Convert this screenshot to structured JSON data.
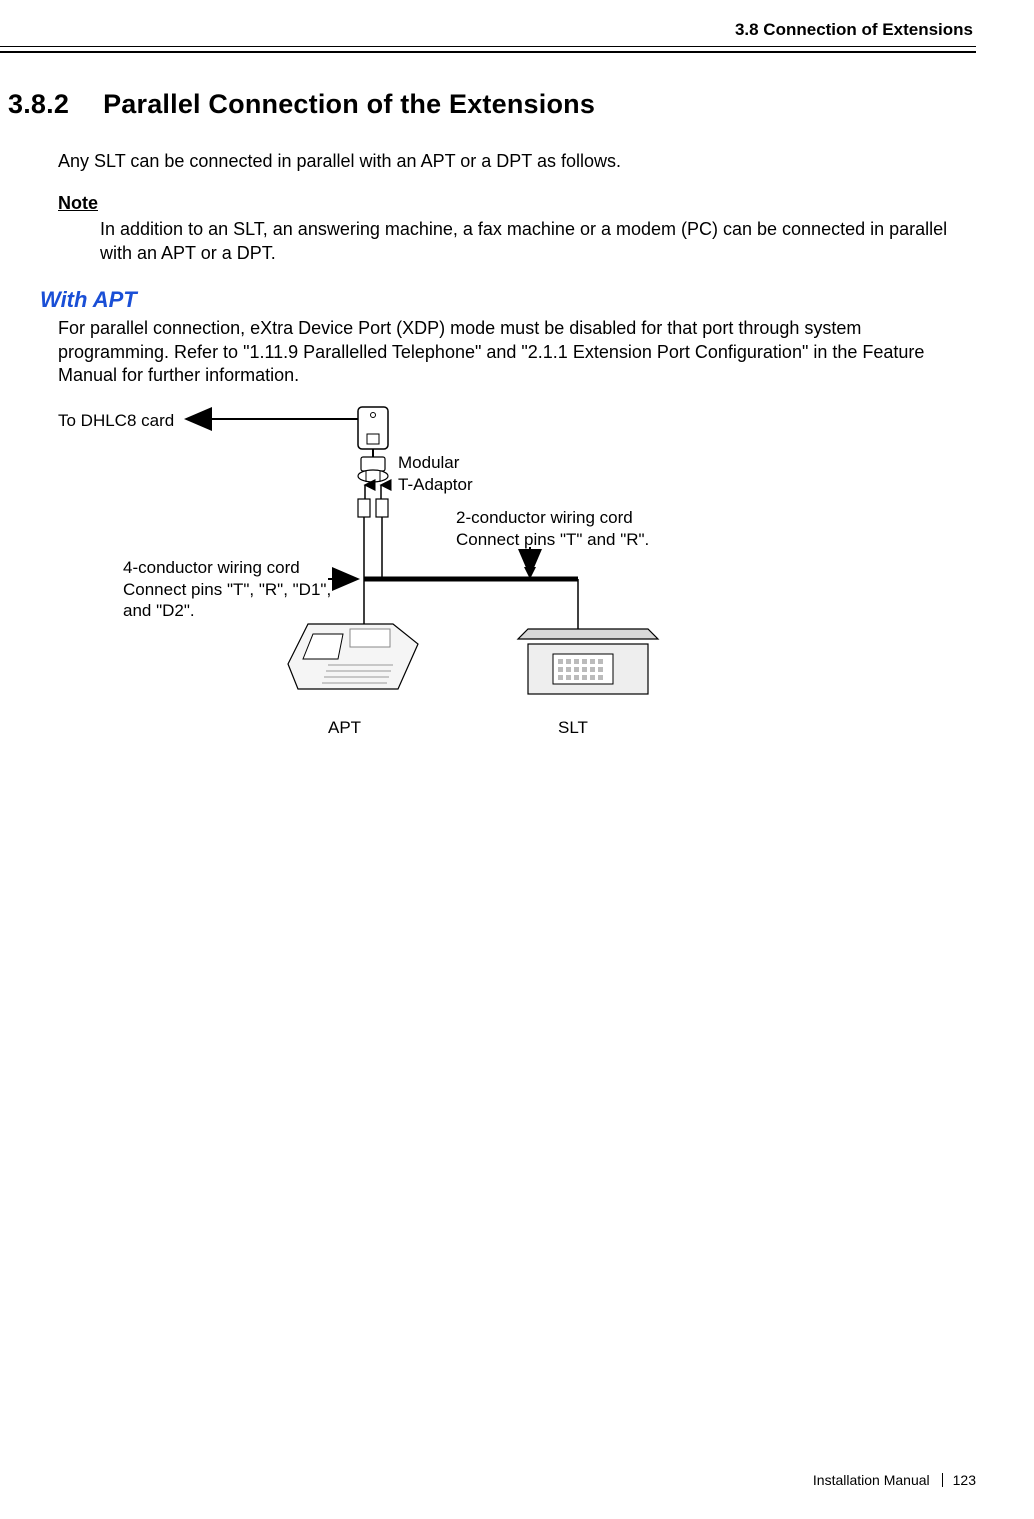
{
  "header": {
    "breadcrumb": "3.8 Connection of Extensions"
  },
  "section": {
    "number": "3.8.2",
    "title": "Parallel Connection of the Extensions",
    "intro": "Any SLT can be connected in parallel with an APT or a DPT as follows.",
    "note_label": "Note",
    "note_body": "In addition to an SLT, an answering machine, a fax machine or a modem (PC) can be connected in parallel with an APT or a DPT."
  },
  "with_apt": {
    "heading": "With APT",
    "body": "For parallel connection, eXtra Device Port (XDP) mode must be disabled for that port through system programming. Refer to \"1.11.9 Parallelled Telephone\" and \"2.1.1 Extension Port Configuration\" in the Feature Manual for further information."
  },
  "diagram": {
    "to_dhlc8": "To DHLC8 card",
    "modular_t_adaptor": "Modular\nT-Adaptor",
    "four_conductor": "4-conductor wiring cord\nConnect pins \"T\", \"R\", \"D1\",\nand \"D2\".",
    "two_conductor": "2-conductor wiring cord\nConnect pins \"T\" and \"R\".",
    "apt_label": "APT",
    "slt_label": "SLT"
  },
  "footer": {
    "manual": "Installation Manual",
    "page": "123"
  }
}
